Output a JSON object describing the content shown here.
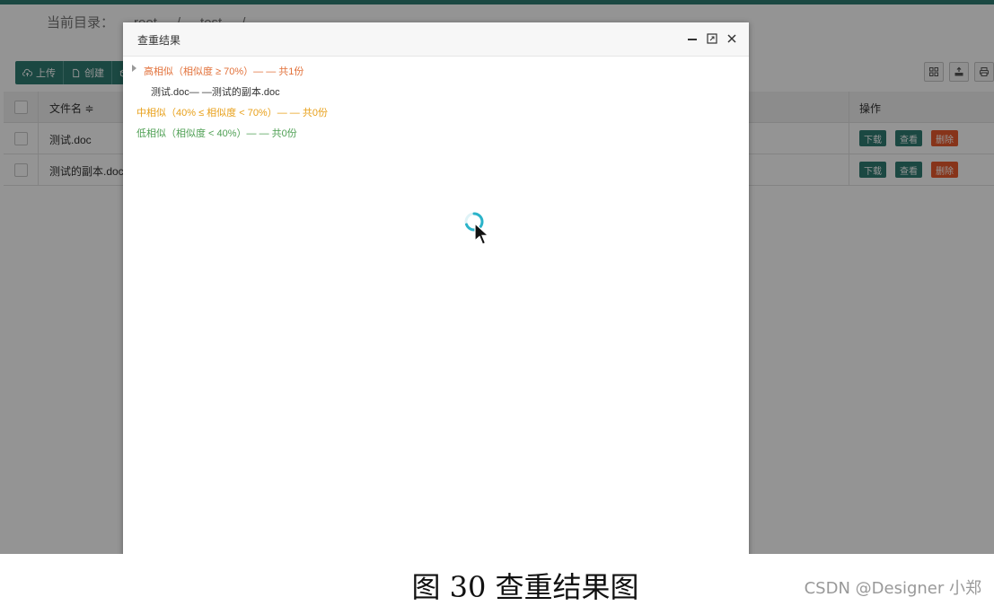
{
  "app": {
    "breadcrumb": {
      "label": "当前目录：",
      "parts": [
        "root",
        "/",
        "test",
        "/"
      ]
    },
    "toolbar": {
      "upload_label": "上传",
      "create_label": "创建"
    },
    "table": {
      "headers": {
        "filename": "文件名 ≑",
        "operation": "操作"
      },
      "rows": [
        {
          "filename": "测试.doc",
          "download": "下载",
          "view": "查看",
          "delete": "删除"
        },
        {
          "filename": "测试的副本.doc",
          "download": "下载",
          "view": "查看",
          "delete": "删除"
        }
      ]
    }
  },
  "dialog": {
    "title": "查重结果",
    "results": {
      "high": "高相似（相似度 ≥ 70%）— — 共1份",
      "high_item": "测试.doc— —测试的副本.doc",
      "mid": "中相似（40% ≤ 相似度 < 70%）— — 共0份",
      "low": "低相似（相似度 < 40%）— — 共0份"
    }
  },
  "colors": {
    "primary": "#2f7c73",
    "danger": "#e85b2d",
    "high": "#e2713a",
    "mid": "#e8a01a",
    "low": "#4e9f53"
  },
  "caption": "图 30 查重结果图",
  "watermark": "CSDN @Designer 小郑"
}
